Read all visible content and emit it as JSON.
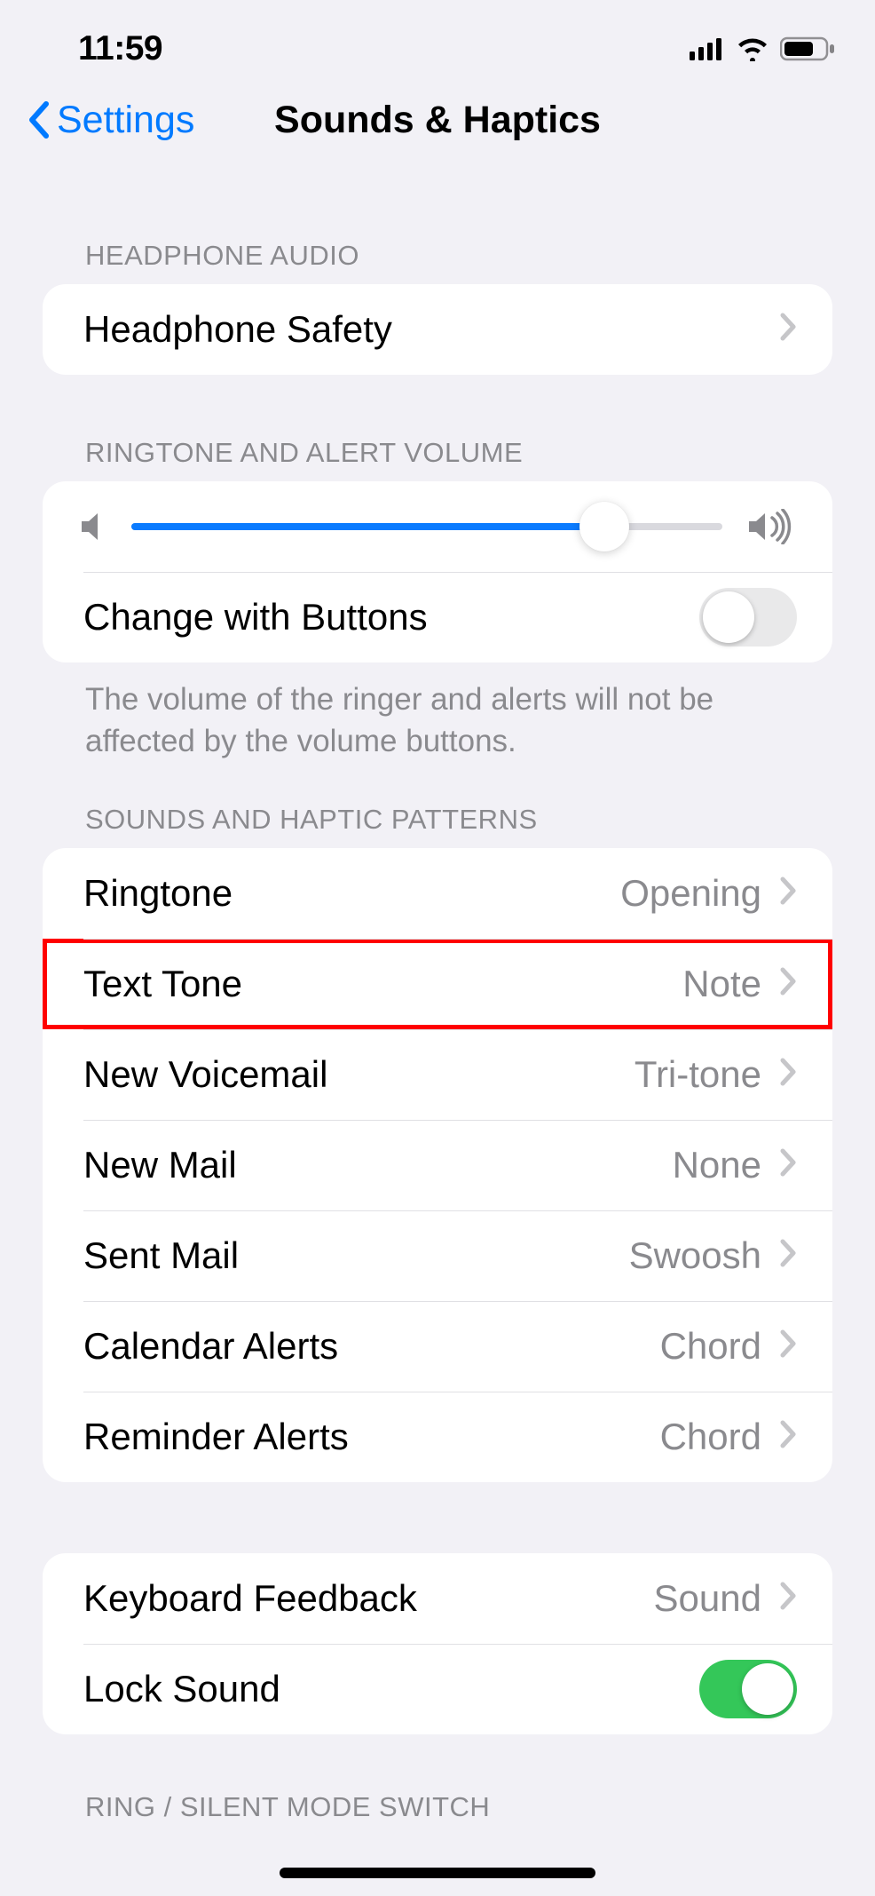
{
  "status": {
    "time": "11:59"
  },
  "nav": {
    "back_label": "Settings",
    "title": "Sounds & Haptics"
  },
  "sections": {
    "headphone_audio": {
      "header": "HEADPHONE AUDIO",
      "rows": {
        "headphone_safety": {
          "label": "Headphone Safety"
        }
      }
    },
    "ringtone_volume": {
      "header": "RINGTONE AND ALERT VOLUME",
      "slider_percent": 80,
      "change_with_buttons": {
        "label": "Change with Buttons",
        "on": false
      },
      "footer": "The volume of the ringer and alerts will not be affected by the volume buttons."
    },
    "sounds_patterns": {
      "header": "SOUNDS AND HAPTIC PATTERNS",
      "rows": [
        {
          "label": "Ringtone",
          "value": "Opening",
          "highlight": false
        },
        {
          "label": "Text Tone",
          "value": "Note",
          "highlight": true
        },
        {
          "label": "New Voicemail",
          "value": "Tri-tone",
          "highlight": false
        },
        {
          "label": "New Mail",
          "value": "None",
          "highlight": false
        },
        {
          "label": "Sent Mail",
          "value": "Swoosh",
          "highlight": false
        },
        {
          "label": "Calendar Alerts",
          "value": "Chord",
          "highlight": false
        },
        {
          "label": "Reminder Alerts",
          "value": "Chord",
          "highlight": false
        }
      ]
    },
    "keyboard_lock": {
      "rows": {
        "keyboard_feedback": {
          "label": "Keyboard Feedback",
          "value": "Sound"
        },
        "lock_sound": {
          "label": "Lock Sound",
          "on": true
        }
      }
    },
    "ring_silent": {
      "header": "RING / SILENT MODE SWITCH"
    }
  }
}
